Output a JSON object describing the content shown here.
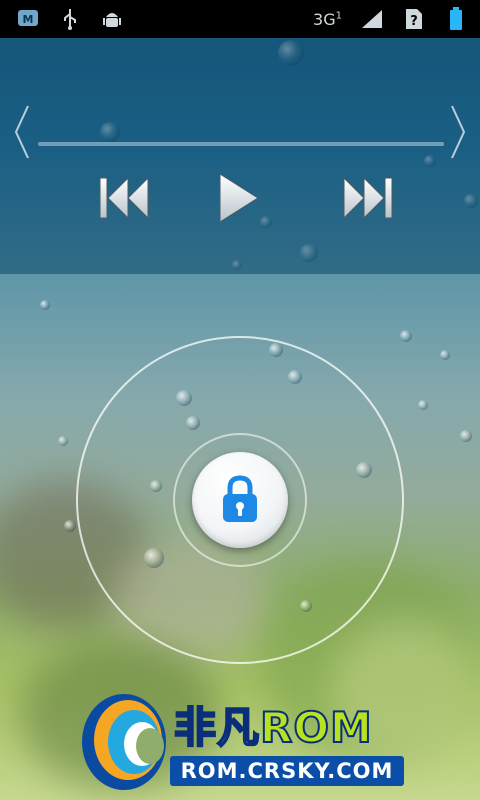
{
  "status_bar": {
    "network_label": "3G",
    "signal_sub": "1",
    "left_icons": [
      "sync-icon",
      "usb-icon",
      "android-debug-icon"
    ],
    "right_icons": [
      "signal-icon",
      "sim-unknown-icon",
      "battery-icon"
    ]
  },
  "media": {
    "controls": [
      "previous-track",
      "play",
      "next-track"
    ],
    "progress": 0
  },
  "lock": {
    "icon": "padlock-icon",
    "accent": "#1e88e5"
  },
  "watermark": {
    "title_cn": "非凡",
    "title_rom": "ROM",
    "url": "ROM.CRSKY.COM"
  }
}
